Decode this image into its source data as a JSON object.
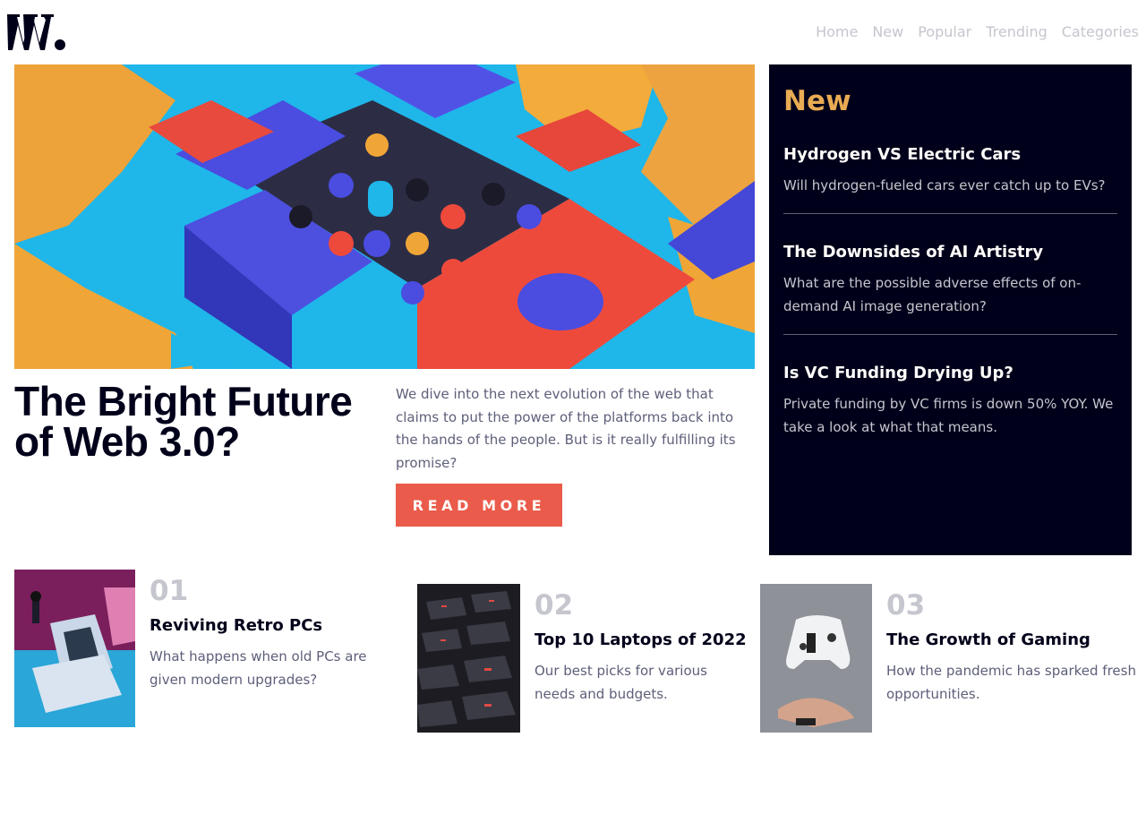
{
  "brand": {
    "logo_text": "W"
  },
  "nav": {
    "items": [
      "Home",
      "New",
      "Popular",
      "Trending",
      "Categories"
    ]
  },
  "hero": {
    "title": "The Bright Future of Web 3.0?",
    "description": "We dive into the next evolution of the web that claims to put the power of the platforms back into the hands of the people. But is it really fulfilling its promise?",
    "button_label": "READ MORE"
  },
  "new_section": {
    "heading": "New",
    "items": [
      {
        "title": "Hydrogen VS Electric Cars",
        "description": "Will hydrogen-fueled cars ever catch up to EVs?"
      },
      {
        "title": "The Downsides of AI Artistry",
        "description": "What are the possible adverse effects of on-demand AI image generation?"
      },
      {
        "title": "Is VC Funding Drying Up?",
        "description": "Private funding by VC firms is down 50% YOY. We take a look at what that means."
      }
    ]
  },
  "cards": [
    {
      "number": "01",
      "title": "Reviving Retro PCs",
      "description": "What happens when old PCs are given modern upgrades?"
    },
    {
      "number": "02",
      "title": "Top 10 Laptops of 2022",
      "description": "Our best picks for various needs and budgets."
    },
    {
      "number": "03",
      "title": "The Growth of Gaming",
      "description": "How the pandemic has sparked fresh opportunities."
    }
  ],
  "colors": {
    "accent_orange": "#e9ab53",
    "accent_red": "#ea5b4b",
    "dark_navy": "#00001a",
    "grayish_blue": "#5d5f79",
    "muted_gray": "#c5c6ce"
  }
}
